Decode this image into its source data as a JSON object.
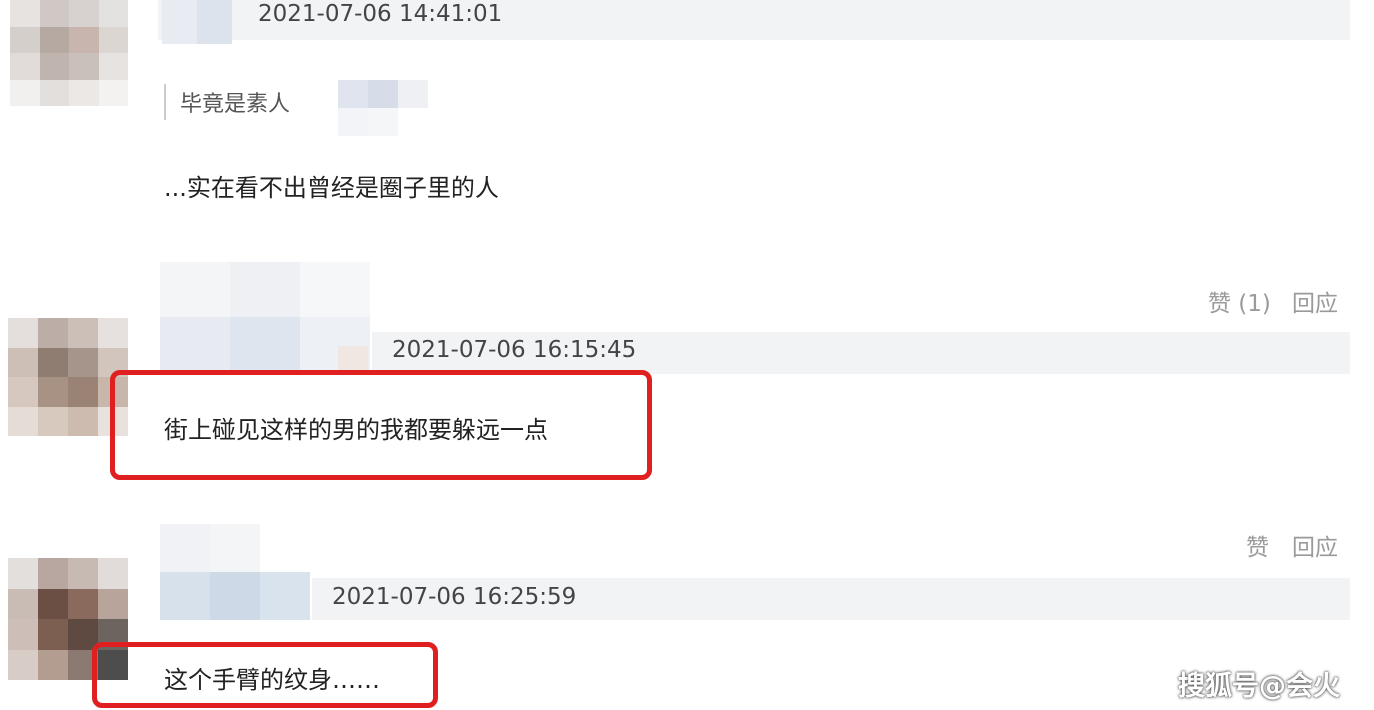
{
  "comments": [
    {
      "timestamp": "2021-07-06 14:41:01",
      "quote": "毕竟是素人",
      "text": "...实在看不出曾经是圈子里的人"
    },
    {
      "timestamp": "2021-07-06 16:15:45",
      "text": "街上碰见这样的男的我都要躲远一点",
      "like_label": "赞 (1)",
      "reply_label": "回应"
    },
    {
      "timestamp": "2021-07-06 16:25:59",
      "text": "这个手臂的纹身……",
      "like_label": "赞",
      "reply_label": "回应"
    }
  ],
  "watermark": "搜狐号@会火",
  "colors": {
    "highlight": "#e02020",
    "header_bg": "#f2f3f5",
    "action_text": "#9a9a9a"
  }
}
